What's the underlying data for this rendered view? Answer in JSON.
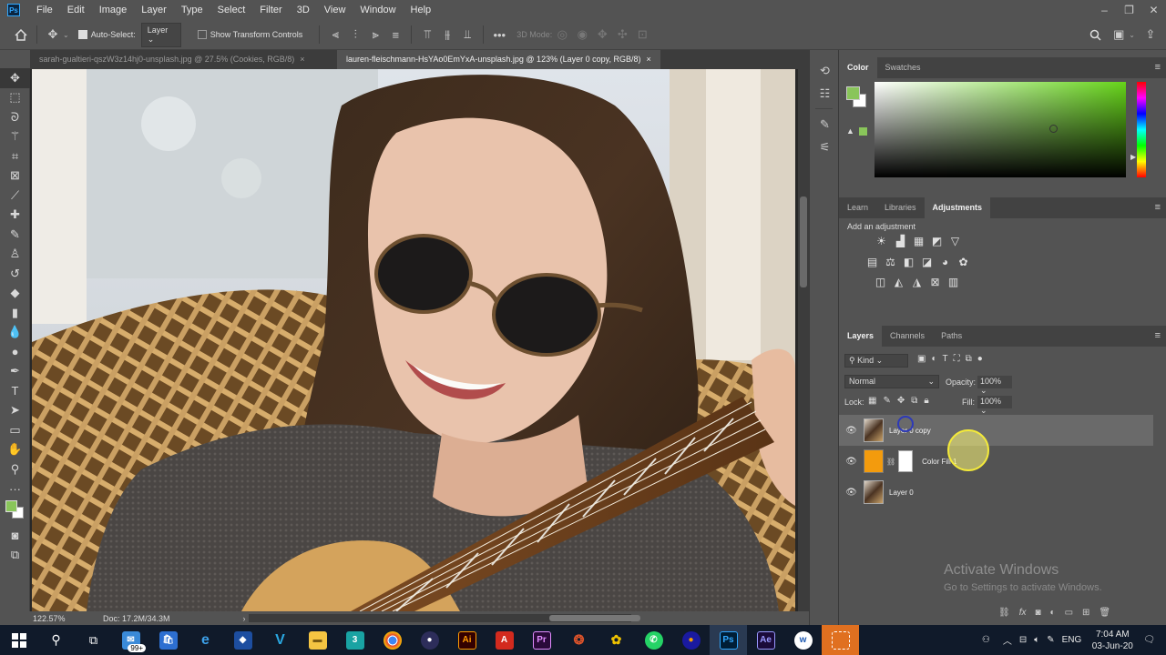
{
  "menubar": {
    "logo": "Ps",
    "items": [
      "File",
      "Edit",
      "Image",
      "Layer",
      "Type",
      "Select",
      "Filter",
      "3D",
      "View",
      "Window",
      "Help"
    ],
    "window_controls": [
      "–",
      "❐",
      "✕"
    ]
  },
  "options_bar": {
    "auto_select_label": "Auto-Select:",
    "auto_select_value": "Layer",
    "show_transform_label": "Show Transform Controls",
    "mode_3d_label": "3D Mode:"
  },
  "tabs": [
    {
      "label": "sarah-gualtieri-qszW3z14hj0-unsplash.jpg @ 27.5% (Cookies, RGB/8)",
      "active": false
    },
    {
      "label": "lauren-fleischmann-HsYAo0EmYxA-unsplash.jpg @ 123% (Layer 0 copy, RGB/8)",
      "active": true
    }
  ],
  "tab_close": "×",
  "status": {
    "zoom": "122.57%",
    "doc": "Doc: 17.2M/34.3M",
    "arrow": "›"
  },
  "color_panel": {
    "tabs": [
      "Color",
      "Swatches"
    ],
    "active": "Color",
    "fg": "#89c55a",
    "bg": "#ffffff",
    "hue_color": "#66d41a"
  },
  "adjustments_panel": {
    "tabs": [
      "Learn",
      "Libraries",
      "Adjustments"
    ],
    "active": "Adjustments",
    "label": "Add an adjustment",
    "icons_row1": [
      "brightness-contrast",
      "levels",
      "curves",
      "exposure",
      "gradient-map-triangle"
    ],
    "icons_row2": [
      "vibrance",
      "hue-saturation",
      "color-balance",
      "black-white",
      "photo-filter",
      "channel-mixer",
      "color-lookup"
    ],
    "icons_row3": [
      "invert",
      "posterize",
      "threshold",
      "selective-color",
      "gradient-map"
    ]
  },
  "layers_panel": {
    "tabs": [
      "Layers",
      "Channels",
      "Paths"
    ],
    "active": "Layers",
    "filter": "Kind",
    "blend_mode": "Normal",
    "opacity_label": "Opacity:",
    "opacity": "100%",
    "lock_label": "Lock:",
    "fill_label": "Fill:",
    "fill": "100%",
    "layers": [
      {
        "name": "Layer 0 copy",
        "selected": true,
        "type": "image"
      },
      {
        "name": "Color Fill 1",
        "selected": false,
        "type": "fill",
        "fill_color": "#f39b0d"
      },
      {
        "name": "Layer 0",
        "selected": false,
        "type": "image"
      }
    ]
  },
  "watermark": {
    "title": "Activate Windows",
    "subtitle": "Go to Settings to activate Windows."
  },
  "taskbar": {
    "mail_badge": "99+",
    "ps": "Ps",
    "ae": "Ae",
    "ai": "Ai",
    "pr": "Pr",
    "vi": "V",
    "num": "3",
    "lang": "ENG",
    "time": "7:04 AM",
    "date": "03-Jun-20"
  }
}
